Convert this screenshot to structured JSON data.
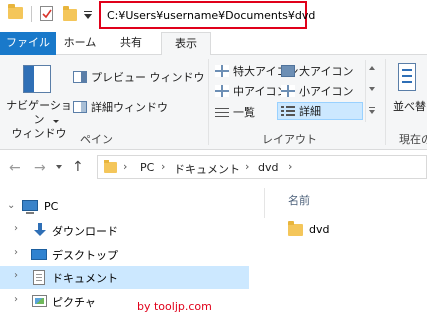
{
  "title_path": "C:¥Users¥username¥Documents¥dvd",
  "tabs": [
    {
      "label": "ファイル"
    },
    {
      "label": "ホーム"
    },
    {
      "label": "共有"
    },
    {
      "label": "表示"
    }
  ],
  "ribbon": {
    "pane_group": {
      "navigation_pane_label_line1": "ナビゲーション",
      "navigation_pane_label_line2": "ウィンドウ",
      "preview_pane": "プレビュー ウィンドウ",
      "details_pane": "詳細ウィンドウ",
      "group_label": "ペイン"
    },
    "layout_group": {
      "items": [
        {
          "label": "特大アイコン"
        },
        {
          "label": "大アイコン"
        },
        {
          "label": "中アイコン"
        },
        {
          "label": "小アイコン"
        },
        {
          "label": "一覧"
        },
        {
          "label": "詳細"
        }
      ],
      "selected": "詳細",
      "group_label": "レイアウト"
    },
    "sort_label": "並べ替",
    "current_view_label": "現在の"
  },
  "address": {
    "segments": [
      "PC",
      "ドキュメント",
      "dvd"
    ]
  },
  "nav_tree": [
    {
      "label": "PC",
      "icon": "pc-icon"
    },
    {
      "label": "ダウンロード",
      "icon": "download-icon"
    },
    {
      "label": "デスクトップ",
      "icon": "desktop-icon"
    },
    {
      "label": "ドキュメント",
      "icon": "documents-icon",
      "selected": true
    },
    {
      "label": "ピクチャ",
      "icon": "pictures-icon"
    }
  ],
  "content": {
    "column_header": "名前",
    "files": [
      {
        "name": "dvd",
        "icon": "folder-icon"
      }
    ]
  },
  "watermark": "by tooljp.com",
  "colors": {
    "file_tab": "#1979ca",
    "highlight_border": "#e0001a",
    "selection": "#cce8ff"
  }
}
